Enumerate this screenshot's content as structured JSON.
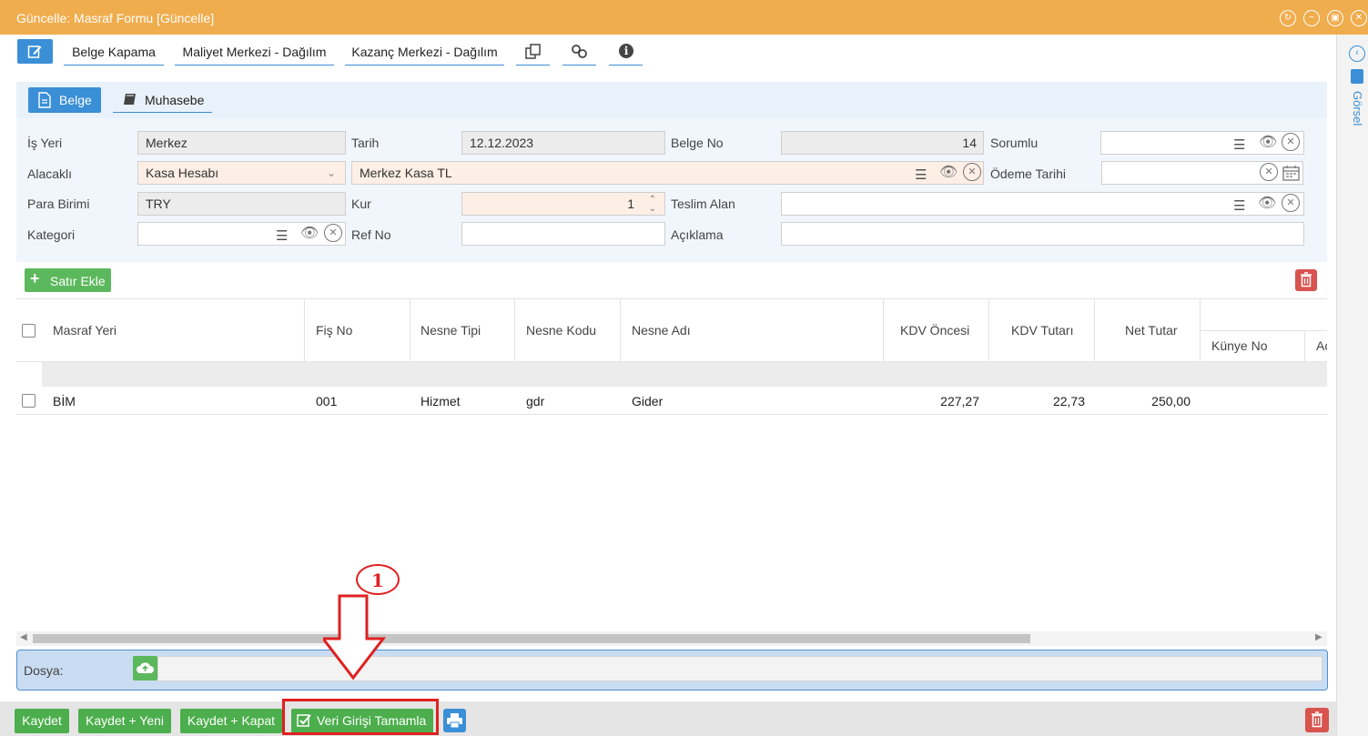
{
  "window": {
    "title": "Güncelle: Masraf Formu [Güncelle]"
  },
  "toolbar": {
    "belge_kapama": "Belge Kapama",
    "maliyet": "Maliyet Merkezi - Dağılım",
    "kazanc": "Kazanç Merkezi - Dağılım"
  },
  "side": {
    "gorsel": "Görsel"
  },
  "tabs": {
    "belge": "Belge",
    "muhasebe": "Muhasebe"
  },
  "form": {
    "is_yeri_label": "İş Yeri",
    "is_yeri": "Merkez",
    "tarih_label": "Tarih",
    "tarih": "12.12.2023",
    "belge_no_label": "Belge No",
    "belge_no": "14",
    "sorumlu_label": "Sorumlu",
    "sorumlu": "",
    "alacakli_label": "Alacaklı",
    "alacakli": "Kasa Hesabı",
    "alacakli_hesap": "Merkez Kasa TL",
    "odeme_tarihi_label": "Ödeme Tarihi",
    "odeme_tarihi": "",
    "para_birimi_label": "Para Birimi",
    "para_birimi": "TRY",
    "kur_label": "Kur",
    "kur": "1",
    "teslim_alan_label": "Teslim Alan",
    "teslim_alan": "",
    "kategori_label": "Kategori",
    "kategori": "",
    "ref_no_label": "Ref No",
    "ref_no": "",
    "aciklama_label": "Açıklama",
    "aciklama": ""
  },
  "grid": {
    "add_row": "Satır Ekle",
    "columns": [
      "Masraf Yeri",
      "Fiş No",
      "Nesne Tipi",
      "Nesne Kodu",
      "Nesne Adı",
      "KDV Öncesi",
      "KDV Tutarı",
      "Net Tutar",
      "Künye No",
      "Ac"
    ],
    "rows": [
      {
        "masraf_yeri": "BİM",
        "fis_no": "001",
        "nesne_tipi": "Hizmet",
        "nesne_kodu": "gdr",
        "nesne_adi": "Gider",
        "kdv_oncesi": "227,27",
        "kdv_tutari": "22,73",
        "net_tutar": "250,00"
      }
    ]
  },
  "dosya": {
    "label": "Dosya:"
  },
  "bottom": {
    "kaydet": "Kaydet",
    "kaydet_yeni": "Kaydet + Yeni",
    "kaydet_kapat": "Kaydet + Kapat",
    "veri_girisi": "Veri Girişi Tamamla"
  },
  "annotation": {
    "number": "1"
  },
  "colors": {
    "titlebar": "#f0ad4e",
    "accent": "#3a8fd6",
    "success": "#4cae4c",
    "danger": "#d9534f",
    "highlight": "#e02020"
  }
}
